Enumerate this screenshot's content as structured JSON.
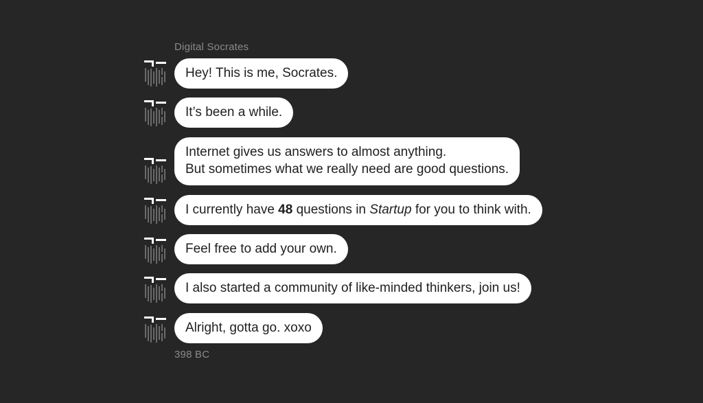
{
  "chat": {
    "sender_name": "Digital Socrates",
    "timestamp": "398 BC",
    "messages": [
      {
        "id": "m1",
        "text": "Hey! This is me, Socrates."
      },
      {
        "id": "m2",
        "text": "It’s been a while."
      },
      {
        "id": "m3",
        "lines": [
          "Internet gives us answers to almost anything.",
          "But sometimes what we really need are good questions."
        ]
      },
      {
        "id": "m4",
        "parts": {
          "before": "I currently have ",
          "count": "48",
          "middle": " questions in ",
          "category": "Startup",
          "after": " for you to think with."
        }
      },
      {
        "id": "m5",
        "text": "Feel free to add your own."
      },
      {
        "id": "m6",
        "text": "I also started a community of like-minded thinkers, join us!"
      },
      {
        "id": "m7",
        "text": "Alright, gotta go. xoxo"
      }
    ],
    "avatar_icon": "socrates-bust-icon"
  },
  "colors": {
    "background": "#262626",
    "bubble": "#ffffff",
    "bubble_text": "#1f1f1f",
    "meta_text": "#8a8a8a",
    "avatar": "#ffffff"
  }
}
